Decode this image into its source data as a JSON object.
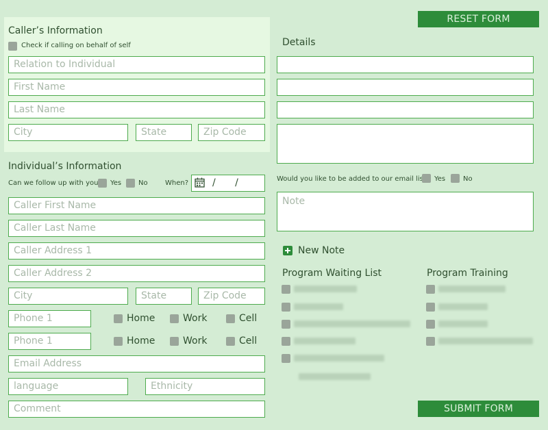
{
  "buttons": {
    "reset": "RESET FORM",
    "submit": "SUBMIT FORM"
  },
  "caller": {
    "title": "Caller’s Information",
    "self_check_label": "Check if calling on behalf of self",
    "relation_placeholder": "Relation to Individual",
    "first_name_placeholder": "First Name",
    "last_name_placeholder": "Last Name",
    "city_placeholder": "City",
    "state_placeholder": "State",
    "zip_placeholder": "Zip Code"
  },
  "individual": {
    "title": "Individual’s Information",
    "follow_up_question": "Can we follow up with you?",
    "yes_label": "Yes",
    "no_label": "No",
    "when_label": "When?",
    "date_value": "/ /",
    "caller_first_name_placeholder": "Caller First Name",
    "caller_last_name_placeholder": "Caller Last Name",
    "address1_placeholder": "Caller Address 1",
    "address2_placeholder": "Caller Address 2",
    "city_placeholder": "City",
    "state_placeholder": "State",
    "zip_placeholder": "Zip Code",
    "phone1_placeholder": "Phone 1",
    "phone2_placeholder": "Phone 1",
    "home_label": "Home",
    "work_label": "Work",
    "cell_label": "Cell",
    "email_placeholder": "Email Address",
    "language_placeholder": "language",
    "ethnicity_placeholder": "Ethnicity",
    "comment_placeholder": "Comment"
  },
  "details": {
    "title": "Details",
    "email_list_question": "Would you like to be added to our email list?",
    "yes_label": "Yes",
    "no_label": "No",
    "note_placeholder": "Note",
    "new_note_label": "New Note"
  },
  "programs": {
    "waiting_list_title": "Program Waiting List",
    "training_title": "Program Training"
  },
  "colors": {
    "background": "#d4ecd4",
    "accent": "#2d8c3a",
    "field_border": "#4caa4c"
  }
}
